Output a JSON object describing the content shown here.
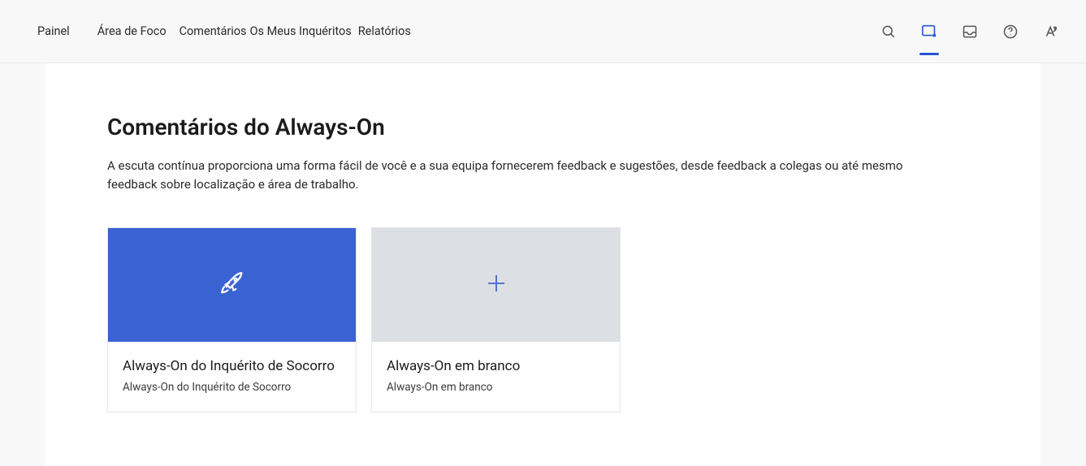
{
  "nav": {
    "items": [
      "Painel",
      "Área de Foco",
      "Comentários",
      "Os Meus Inquéritos",
      "Relatórios"
    ]
  },
  "page": {
    "title": "Comentários do Always-On",
    "description": "A escuta contínua proporciona uma forma fácil de você e a sua equipa fornecerem feedback e sugestões, desde feedback a colegas ou até mesmo feedback sobre localização e área de trabalho."
  },
  "cards": [
    {
      "title": "Always-On do Inquérito de Socorro",
      "subtitle": "Always-On do Inquérito de Socorro"
    },
    {
      "title": "Always-On em branco",
      "subtitle": "Always-On em branco"
    }
  ]
}
